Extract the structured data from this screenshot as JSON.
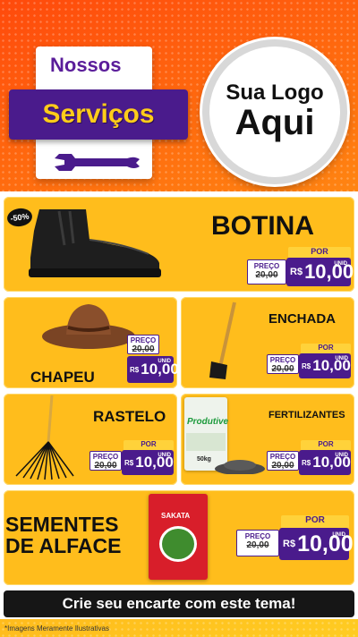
{
  "header": {
    "services_line1": "Nossos",
    "services_line2": "Serviços",
    "logo_line1": "Sua Logo",
    "logo_line2": "Aqui"
  },
  "products": [
    {
      "name": "BOTINA",
      "badge": "-50%",
      "preco_label": "PREÇO",
      "old_price": "20,00",
      "por_label": "POR",
      "currency": "R$",
      "price": "10,00",
      "unit": "UNID"
    },
    {
      "name": "CHAPEU",
      "preco_label": "PREÇO",
      "old_price": "20,00",
      "por_label": "POR",
      "currency": "R$",
      "price": "10,00",
      "unit": "UNID"
    },
    {
      "name": "ENCHADA",
      "preco_label": "PREÇO",
      "old_price": "20,00",
      "por_label": "POR",
      "currency": "R$",
      "price": "10,00",
      "unit": "UNID"
    },
    {
      "name": "RASTELO",
      "preco_label": "PREÇO",
      "old_price": "20,00",
      "por_label": "POR",
      "currency": "R$",
      "price": "10,00",
      "unit": "UNID"
    },
    {
      "name": "FERTILIZANTES",
      "preco_label": "PREÇO",
      "old_price": "20,00",
      "por_label": "POR",
      "currency": "R$",
      "price": "10,00",
      "unit": "UNID",
      "bag_brand": "Produtive",
      "bag_weight": "50kg"
    },
    {
      "name_line1": "SEMENTES",
      "name_line2": "DE ALFACE",
      "preco_label": "PREÇO",
      "old_price": "20,00",
      "por_label": "POR",
      "currency": "R$",
      "price": "10,00",
      "unit": "UNID",
      "package_brand": "SAKATA"
    }
  ],
  "footer": {
    "cta": "Crie seu encarte com este tema!",
    "disclaimer": "*Imagens Meramente Ilustrativas"
  },
  "colors": {
    "purple": "#4a1b8c",
    "yellow": "#ffbd1c",
    "orange": "#ff6a10",
    "black": "#161616"
  }
}
